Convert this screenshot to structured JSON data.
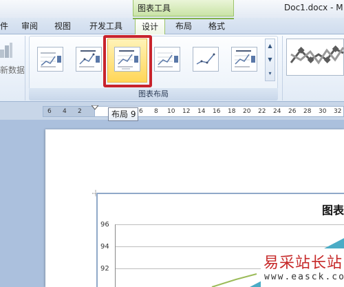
{
  "window": {
    "context_group_label": "图表工具",
    "doc_title": "Doc1.docx - M"
  },
  "tabs": [
    {
      "label": "件"
    },
    {
      "label": "审阅"
    },
    {
      "label": "视图"
    },
    {
      "label": "开发工具"
    },
    {
      "label": "设计",
      "active": true
    },
    {
      "label": "布局"
    },
    {
      "label": "格式"
    }
  ],
  "ribbon": {
    "data_button_label": "新数据",
    "layout_group_label": "图表布局",
    "gallery_selected_index": 2
  },
  "ruler": {
    "ticks": [
      "6",
      "4",
      "2",
      "2",
      "4",
      "6",
      "8",
      "10",
      "12",
      "14",
      "16",
      "18",
      "20",
      "22",
      "24",
      "26",
      "28",
      "30",
      "32"
    ]
  },
  "tooltip": {
    "text": "布局 9"
  },
  "chart": {
    "title": "图表"
  },
  "chart_data": {
    "type": "line",
    "title": "图表",
    "xlabel": "",
    "ylabel": "",
    "ytick_labels": [
      "96",
      "94",
      "92"
    ],
    "ylim": [
      90,
      96
    ],
    "grid": true
  },
  "watermark": {
    "cn": "易采站长站",
    "url": "www.easck.com"
  },
  "colors": {
    "selection_border": "#c8232c",
    "context_tab": "#9cc36a",
    "workspace": "#abc0dd"
  }
}
